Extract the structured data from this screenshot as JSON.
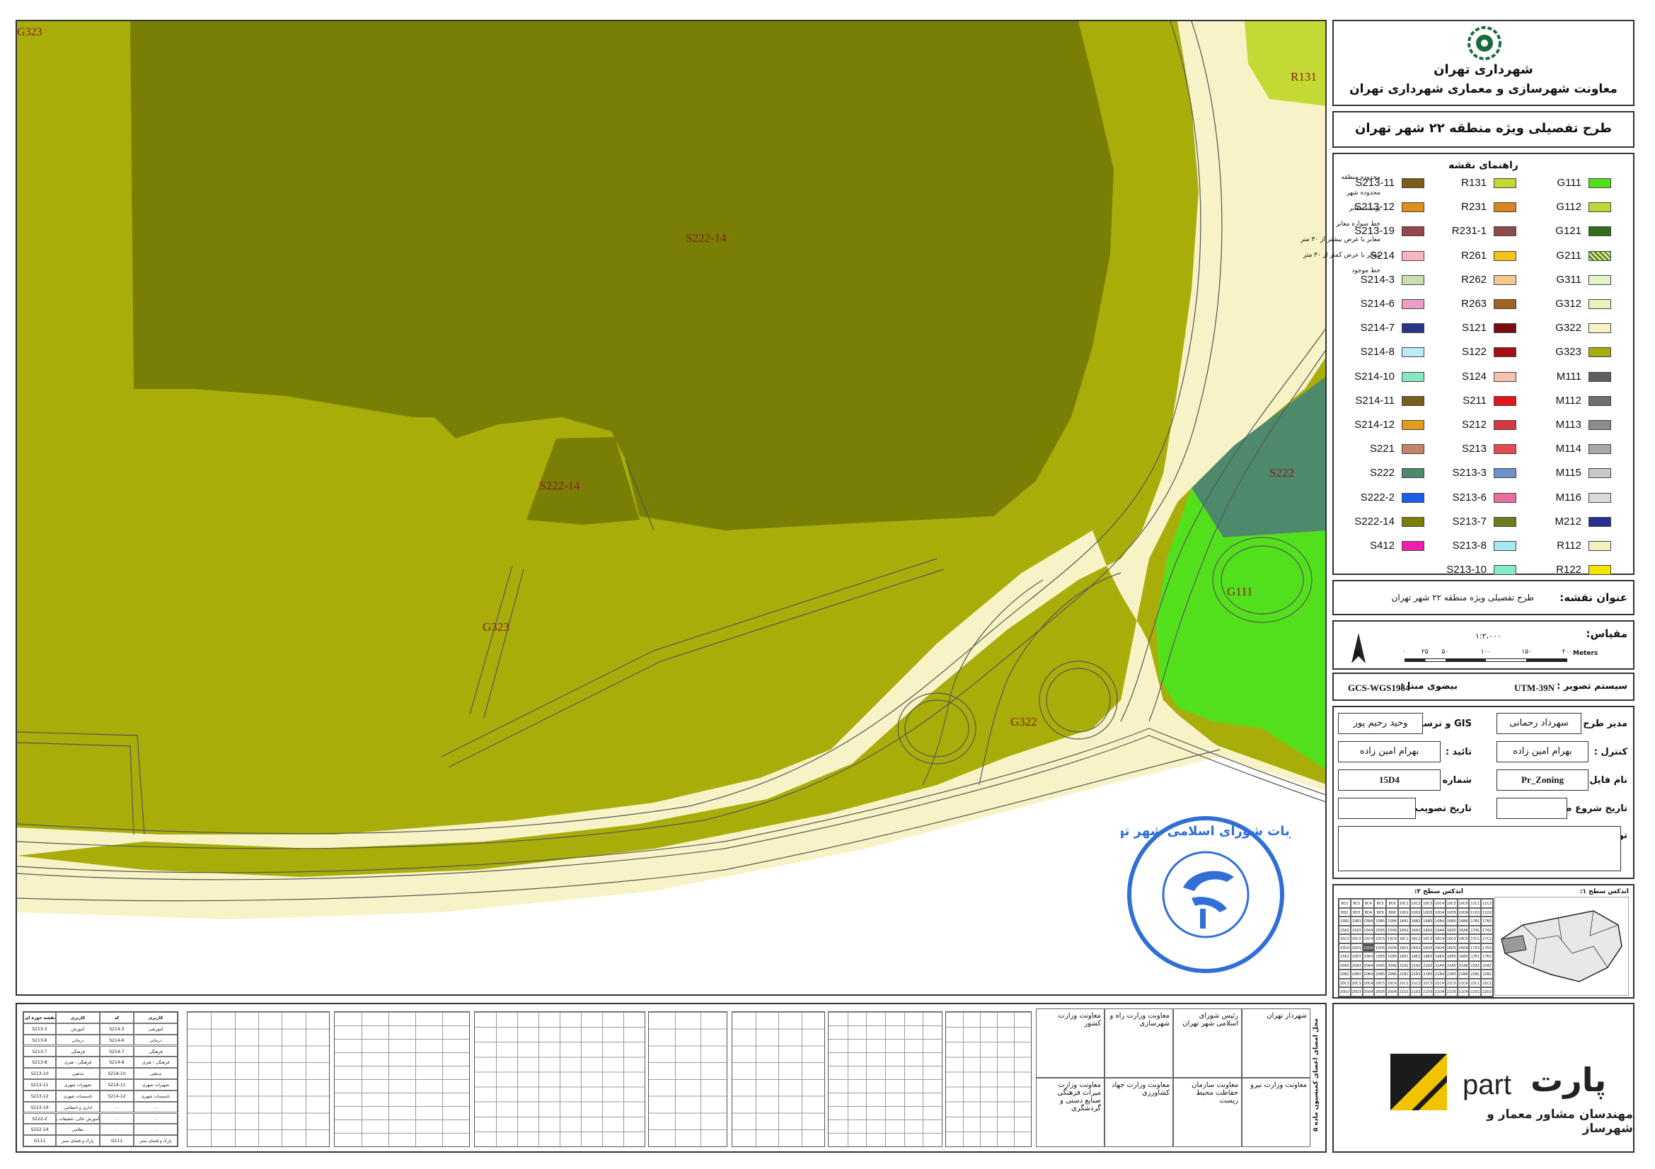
{
  "map": {
    "zone_labels": {
      "g323_top_left": "G323",
      "r131": "R131",
      "s222_14_main": "S222-14",
      "s222_14_small": "S222-14",
      "s222": "S222",
      "g111": "G111",
      "g323": "G323",
      "g322": "G322"
    },
    "colors": {
      "background_zone": "#a9ad0a",
      "dark_olive_zone": "#787f04",
      "road_cream": "#f7f3c6",
      "park_green": "#53e01c",
      "teal_zone": "#4d8a6c",
      "light_green_zone": "#c4d934",
      "road_edge": "#444444"
    }
  },
  "stamp": {
    "text": "مصوبات شورای اسلامی شهر تهران",
    "color": "#2f6fd6"
  },
  "header": {
    "org_name": "شهرداری تهران",
    "org_subtitle": "معاونت شهرسازی و معماری شهرداری تهران",
    "plan_title": "طرح تفصیلی ویژه منطقه ۲۲ شهر تهران"
  },
  "legend": {
    "title": "راهنمای نقشه",
    "columns": [
      [
        {
          "code": "G111",
          "color": "#53e01c"
        },
        {
          "code": "G112",
          "color": "#b9dc34"
        },
        {
          "code": "G121",
          "color": "#2f6e1d"
        },
        {
          "code": "G211",
          "color": "#8eb00f"
        },
        {
          "code": "G311",
          "color": "#e6f5c8"
        },
        {
          "code": "G312",
          "color": "#e9f3b8"
        },
        {
          "code": "G322",
          "color": "#f7f3c6"
        },
        {
          "code": "G323",
          "color": "#a9ad0a"
        },
        {
          "code": "M111",
          "color": "#5f5f5f"
        },
        {
          "code": "M112",
          "color": "#6e6e6e"
        },
        {
          "code": "M113",
          "color": "#8c8c8c"
        },
        {
          "code": "M114",
          "color": "#a8a8a8"
        },
        {
          "code": "M115",
          "color": "#c8c8c8"
        },
        {
          "code": "M116",
          "color": "#d9d9d9"
        },
        {
          "code": "M212",
          "color": "#2a2f8f"
        },
        {
          "code": "R112",
          "color": "#f5efc0"
        },
        {
          "code": "R122",
          "color": "#f5e600"
        }
      ],
      [
        {
          "code": "R131",
          "color": "#c4d934"
        },
        {
          "code": "R231",
          "color": "#d98520"
        },
        {
          "code": "R231-1",
          "color": "#8e4a4a"
        },
        {
          "code": "R261",
          "color": "#f4c21a"
        },
        {
          "code": "R262",
          "color": "#f6c78a"
        },
        {
          "code": "R263",
          "color": "#a1611f"
        },
        {
          "code": "S121",
          "color": "#7a0c10"
        },
        {
          "code": "S122",
          "color": "#a40f12"
        },
        {
          "code": "S124",
          "color": "#f6c2b2"
        },
        {
          "code": "S211",
          "color": "#e2151c"
        },
        {
          "code": "S212",
          "color": "#d33a3f"
        },
        {
          "code": "S213",
          "color": "#e04a50"
        },
        {
          "code": "S213-3",
          "color": "#6c93c9"
        },
        {
          "code": "S213-6",
          "color": "#e66f9e"
        },
        {
          "code": "S213-7",
          "color": "#6f7a1e"
        },
        {
          "code": "S213-8",
          "color": "#a3e8f2"
        },
        {
          "code": "S213-10",
          "color": "#83ebc9"
        }
      ],
      [
        {
          "code": "S213-11",
          "color": "#7a5c1b"
        },
        {
          "code": "S213-12",
          "color": "#e18c1b"
        },
        {
          "code": "S213-19",
          "color": "#96464d"
        },
        {
          "code": "S214",
          "color": "#f6b8be"
        },
        {
          "code": "S214-3",
          "color": "#c8dfae"
        },
        {
          "code": "S214-6",
          "color": "#ec9dc8"
        },
        {
          "code": "S214-7",
          "color": "#2c3288"
        },
        {
          "code": "S214-8",
          "color": "#b9ecf5"
        },
        {
          "code": "S214-10",
          "color": "#87e8c2"
        },
        {
          "code": "S214-11",
          "color": "#7a5c1b"
        },
        {
          "code": "S214-12",
          "color": "#e39b1b"
        },
        {
          "code": "S221",
          "color": "#c3846a"
        },
        {
          "code": "S222",
          "color": "#4d8a6c"
        },
        {
          "code": "S222-2",
          "color": "#1c5ce6"
        },
        {
          "code": "S222-14",
          "color": "#787f04"
        },
        {
          "code": "S412",
          "color": "#f01cae"
        }
      ]
    ],
    "line_items": [
      "محدوده منطقه",
      "محدوده شهر",
      "پوسته معابر",
      "خط سواره معابر",
      "معابر با عرض بیشتر از ۳۰ متر",
      "معابر با عرض کمتر از ۳۰ متر",
      "خط موجود"
    ]
  },
  "map_title_box": {
    "label": "عنوان نقشه:",
    "value": "طرح تفصیلی ویژه منطقه ۲۲ شهر تهران"
  },
  "scale": {
    "label": "مقیاس:",
    "ratio": "۱:۲،۰۰۰",
    "ticks": [
      "۰",
      "۲۵",
      "۵۰",
      "۱۰۰",
      "۱۵۰",
      "۲۰۰"
    ],
    "unit": "Meters",
    "north": "N"
  },
  "projection": {
    "system_label": "سیستم تصویر :",
    "system_value": "UTM-39N",
    "datum_label": "بیضوی مبنا :",
    "datum_value": "GCS-WGS1984"
  },
  "credits": {
    "manager_label": "مدیر طرح :",
    "manager_value": "سهرداد رحمانی",
    "gis_label": "GIS و ترسیم :",
    "gis_value": "وحید رحیم پور",
    "control_label": "کنترل :",
    "control_value": "بهرام امین زاده",
    "approve_label": "تائید :",
    "approve_value": "بهرام امین زاده",
    "file_label": "نام فایل :",
    "file_value": "Pr_Zoning",
    "sheet_label": "شماره نقشه :",
    "sheet_value": "15D4",
    "start_label": "تاریخ شروع طرح :",
    "approval_label": "تاریخ تصویب طرح :",
    "notes_label": "توضیح :"
  },
  "index": {
    "level1_label": "اندکس سطح ۱:",
    "level2_label": "اندکس سطح ۲:",
    "grid_rows": [
      [
        "8C2",
        "8C3",
        "8C4",
        "8C5",
        "8C6",
        "10C1",
        "10C2",
        "10C3",
        "10C4",
        "10C5",
        "10C6",
        "11C1",
        "11C2"
      ],
      [
        "8D2",
        "8D3",
        "8D4",
        "8D5",
        "8D6",
        "10D1",
        "10D2",
        "10D3",
        "10D4",
        "10D5",
        "10D6",
        "11D1",
        "11D2"
      ],
      [
        "15B2",
        "15B3",
        "15B4",
        "15B5",
        "15B6",
        "16B1",
        "16B2",
        "16B3",
        "16B4",
        "16B5",
        "16B6",
        "17B1",
        "17B2"
      ],
      [
        "15A2",
        "15A3",
        "15A4",
        "15A5",
        "15A6",
        "16A1",
        "16A2",
        "16A3",
        "16A4",
        "16A5",
        "16A6",
        "17A1",
        "17A2"
      ],
      [
        "15C2",
        "15C3",
        "15C4",
        "15C5",
        "15C6",
        "16C1",
        "16C2",
        "16C3",
        "16C4",
        "16C5",
        "16C6",
        "17C1",
        "17C2"
      ],
      [
        "15D2",
        "15D3",
        "15D4",
        "15D5",
        "15D6",
        "16D1",
        "16D2",
        "16D3",
        "16D4",
        "16D5",
        "16D6",
        "17D1",
        "17D2"
      ],
      [
        "15E2",
        "15E3",
        "15E4",
        "15E5",
        "15E6",
        "16E1",
        "16E2",
        "16E3",
        "16E4",
        "16E5",
        "16E6",
        "17E1",
        "17E2"
      ],
      [
        "20A2",
        "20A3",
        "20A4",
        "20A5",
        "20A6",
        "21A1",
        "21A2",
        "21A3",
        "21A4",
        "21A5",
        "21A6",
        "22A1",
        "22A2"
      ],
      [
        "20B2",
        "20B3",
        "20B4",
        "20B5",
        "20B6",
        "21B1",
        "21B2",
        "21B3",
        "21B4",
        "21B5",
        "21B6",
        "22B1",
        "22B2"
      ],
      [
        "20C2",
        "20C3",
        "20C4",
        "20C5",
        "20C6",
        "21C1",
        "21C2",
        "21C3",
        "21C4",
        "21C5",
        "21C6",
        "22C1",
        "22C2"
      ],
      [
        "20D2",
        "20D3",
        "20D4",
        "20D5",
        "20D6",
        "21D1",
        "21D2",
        "21D3",
        "21D4",
        "21D5",
        "21D6",
        "22D1",
        "22D2"
      ]
    ]
  },
  "signatures": {
    "side_title": "محل امضای اعضای کمیسیون ماده ۵",
    "cells": [
      "شهردار تهران",
      "رئیس شورای اسلامی شهر تهران",
      "معاونت وزارت راه و شهرسازی",
      "معاونت وزارت کشور",
      "معاونت وزارت نیرو",
      "معاونت سازمان حفاظت محیط زیست",
      "معاونت وزارت جهاد کشاورزی",
      "معاونت وزارت میراث فرهنگی صنایع دستی و گردشگری"
    ]
  },
  "correspondence_table": {
    "headers": [
      "نقشه حوزه ای شهری",
      "کاربری",
      "کد",
      "کاربری"
    ],
    "rows": [
      [
        "S213-3",
        "آموزش",
        "S214-3",
        "آموزشی"
      ],
      [
        "S213-6",
        "درمانی",
        "S214-6",
        "درمانی"
      ],
      [
        "S213-7",
        "فرهنگی",
        "S214-7",
        "فرهنگی"
      ],
      [
        "S213-8",
        "فرهنگی - هنری",
        "S214-8",
        "فرهنگی - هنری"
      ],
      [
        "S213-10",
        "مذهبی",
        "S214-10",
        "مذهبی"
      ],
      [
        "S213-11",
        "تجهیزات شهری",
        "S214-11",
        "تجهیزات شهری"
      ],
      [
        "S213-12",
        "تاسیسات شهری",
        "S214-12",
        "تاسیسات شهری"
      ],
      [
        "S213-19",
        "اداری و انتظامی",
        "-",
        "-"
      ],
      [
        "S222-2",
        "آموزش عالی، تحقیقات و فناوری",
        "-",
        "-"
      ],
      [
        "S222-14",
        "نظامی",
        "-",
        "-"
      ],
      [
        "G111",
        "پارک و فضای سبز",
        "G111",
        "پارک و فضای سبز"
      ]
    ]
  },
  "logo": {
    "brand_latin": "part",
    "brand_farsi": "پارت",
    "tagline": "مهندسان مشاور معمار و شهرساز"
  }
}
